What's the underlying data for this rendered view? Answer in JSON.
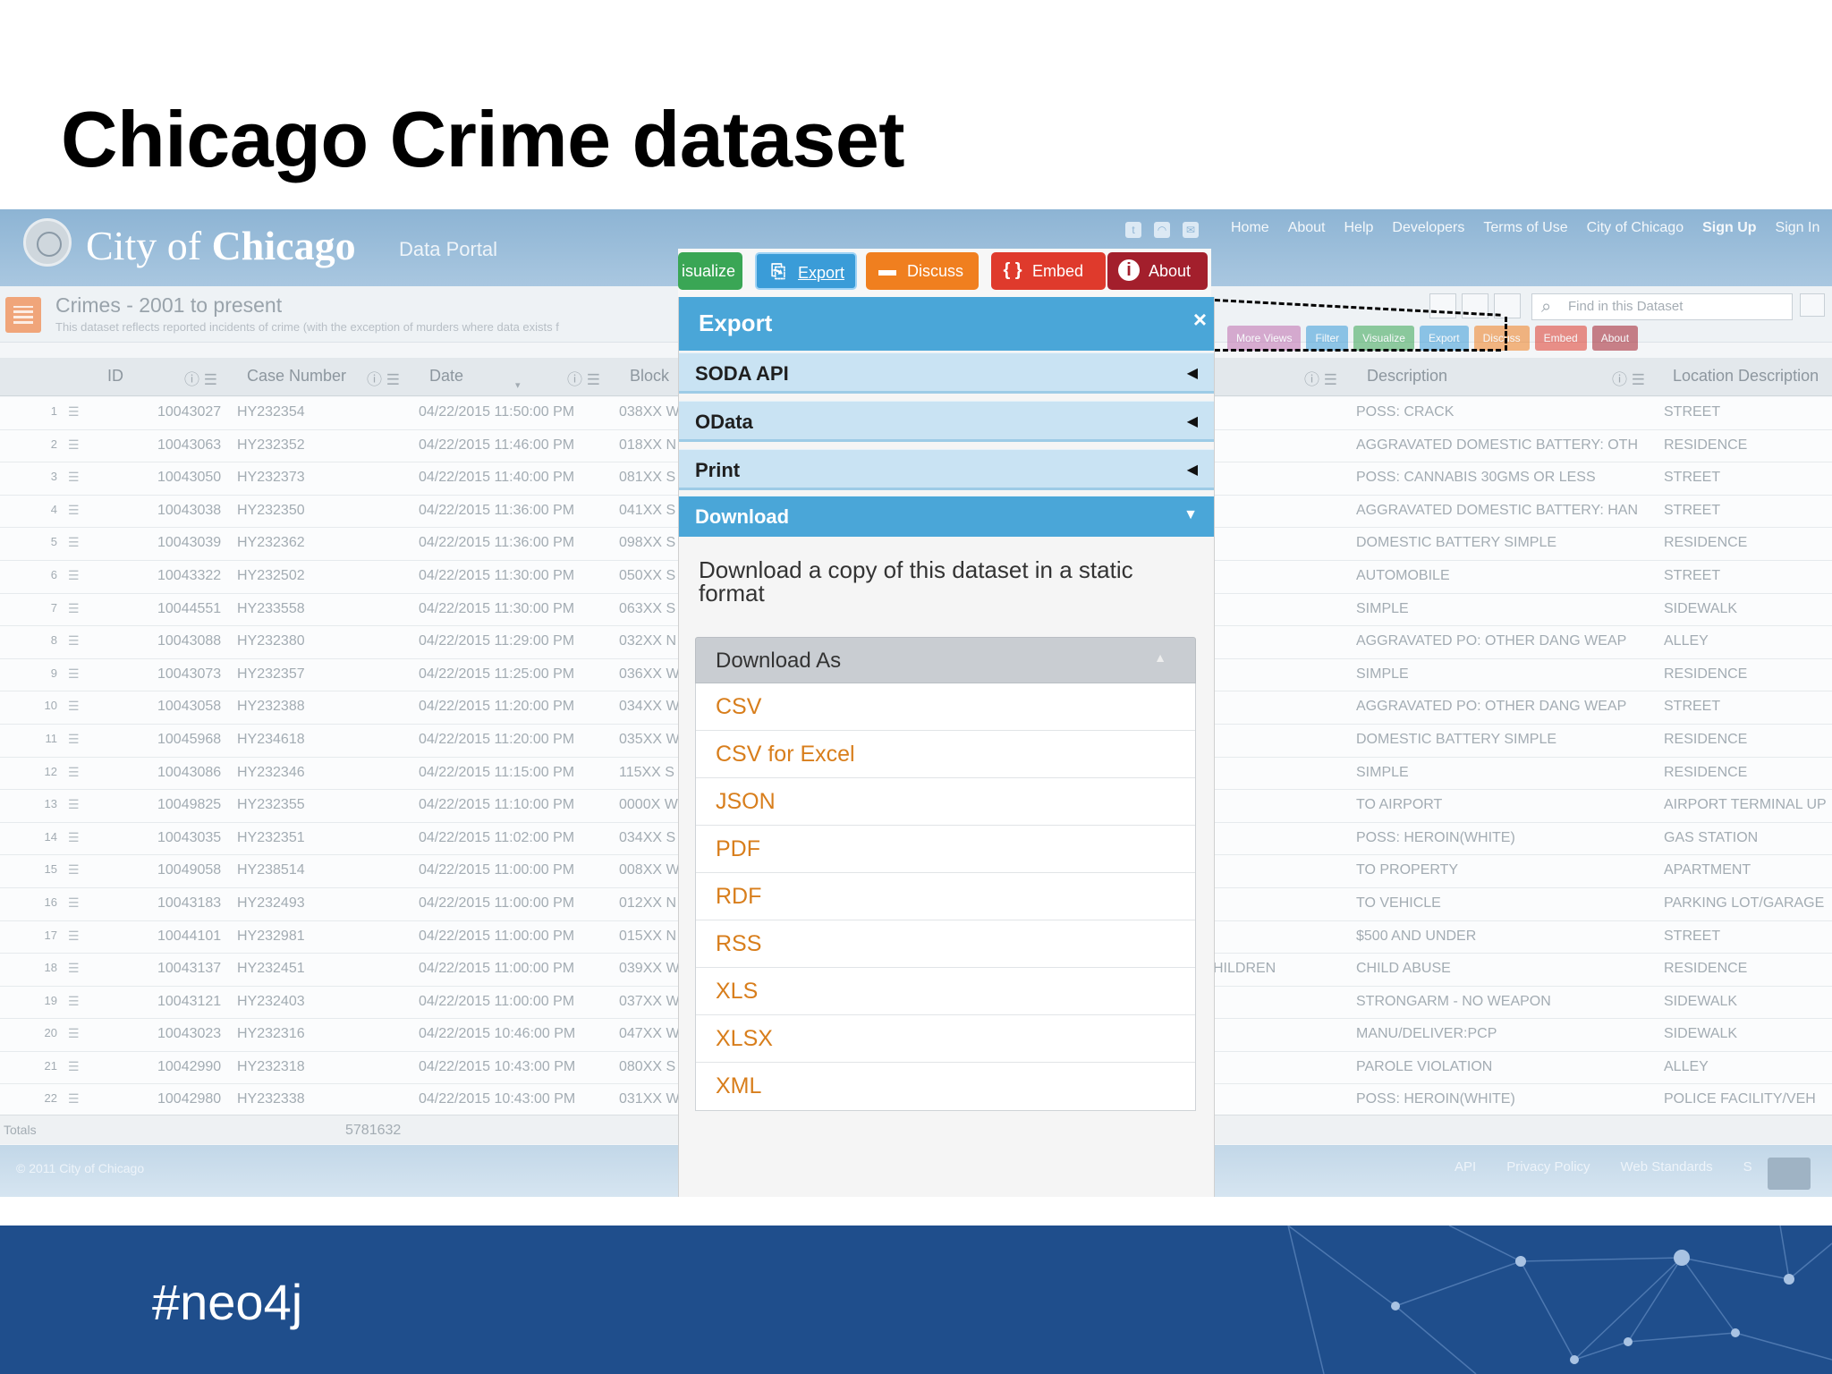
{
  "slide": {
    "title": "Chicago Crime dataset",
    "hashtag": "#neo4j"
  },
  "portal": {
    "brand_light": "City of ",
    "brand_bold": "Chicago",
    "portal_label": "Data Portal",
    "nav": [
      "Home",
      "About",
      "Help",
      "Developers",
      "Terms of Use",
      "City of Chicago",
      "Sign Up",
      "Sign In"
    ],
    "social_icons": [
      "twitter-icon",
      "rss-icon",
      "email-icon"
    ]
  },
  "dataset": {
    "title": "Crimes - 2001 to present",
    "description": "This dataset reflects reported incidents of crime (with the exception of murders where data exists f",
    "search_placeholder": "Find in this Dataset",
    "toolbar": [
      "More Views",
      "Filter",
      "Visualize",
      "Export",
      "Discuss",
      "Embed",
      "About"
    ],
    "toolbar_colors": [
      "#c06fb0",
      "#3a9cd8",
      "#3aa655",
      "#3a9cd8",
      "#f07f1f",
      "#df3a2c",
      "#a31f2c"
    ]
  },
  "table": {
    "columns": [
      "ID",
      "Case Number",
      "Date",
      "Block",
      "Description",
      "Location Description"
    ],
    "rows": [
      {
        "n": "1",
        "id": "10043027",
        "case": "HY232354",
        "date": "04/22/2015 11:50:00 PM",
        "block": "038XX W",
        "extra": "",
        "desc": "POSS: CRACK",
        "loc": "STREET"
      },
      {
        "n": "2",
        "id": "10043063",
        "case": "HY232352",
        "date": "04/22/2015 11:46:00 PM",
        "block": "018XX N",
        "extra": "",
        "desc": "AGGRAVATED DOMESTIC BATTERY: OTH",
        "loc": "RESIDENCE"
      },
      {
        "n": "3",
        "id": "10043050",
        "case": "HY232373",
        "date": "04/22/2015 11:40:00 PM",
        "block": "081XX S",
        "extra": "",
        "desc": "POSS: CANNABIS 30GMS OR LESS",
        "loc": "STREET"
      },
      {
        "n": "4",
        "id": "10043038",
        "case": "HY232350",
        "date": "04/22/2015 11:36:00 PM",
        "block": "041XX S",
        "extra": "",
        "desc": "AGGRAVATED DOMESTIC BATTERY: HAN",
        "loc": "STREET"
      },
      {
        "n": "5",
        "id": "10043039",
        "case": "HY232362",
        "date": "04/22/2015 11:36:00 PM",
        "block": "098XX S",
        "extra": "",
        "desc": "DOMESTIC BATTERY SIMPLE",
        "loc": "RESIDENCE"
      },
      {
        "n": "6",
        "id": "10043322",
        "case": "HY232502",
        "date": "04/22/2015 11:30:00 PM",
        "block": "050XX S",
        "extra": "",
        "desc": "AUTOMOBILE",
        "loc": "STREET"
      },
      {
        "n": "7",
        "id": "10044551",
        "case": "HY233558",
        "date": "04/22/2015 11:30:00 PM",
        "block": "063XX S",
        "extra": "",
        "desc": "SIMPLE",
        "loc": "SIDEWALK"
      },
      {
        "n": "8",
        "id": "10043088",
        "case": "HY232380",
        "date": "04/22/2015 11:29:00 PM",
        "block": "032XX N",
        "extra": "",
        "desc": "AGGRAVATED PO: OTHER DANG WEAP",
        "loc": "ALLEY"
      },
      {
        "n": "9",
        "id": "10043073",
        "case": "HY232357",
        "date": "04/22/2015 11:25:00 PM",
        "block": "036XX W",
        "extra": "",
        "desc": "SIMPLE",
        "loc": "RESIDENCE"
      },
      {
        "n": "10",
        "id": "10043058",
        "case": "HY232388",
        "date": "04/22/2015 11:20:00 PM",
        "block": "034XX W",
        "extra": "",
        "desc": "AGGRAVATED PO: OTHER DANG WEAP",
        "loc": "STREET"
      },
      {
        "n": "11",
        "id": "10045968",
        "case": "HY234618",
        "date": "04/22/2015 11:20:00 PM",
        "block": "035XX W",
        "extra": "",
        "desc": "DOMESTIC BATTERY SIMPLE",
        "loc": "RESIDENCE"
      },
      {
        "n": "12",
        "id": "10043086",
        "case": "HY232346",
        "date": "04/22/2015 11:15:00 PM",
        "block": "115XX S",
        "extra": "",
        "desc": "SIMPLE",
        "loc": "RESIDENCE"
      },
      {
        "n": "13",
        "id": "10049825",
        "case": "HY232355",
        "date": "04/22/2015 11:10:00 PM",
        "block": "0000X W",
        "extra": "",
        "desc": "TO AIRPORT",
        "loc": "AIRPORT TERMINAL UP"
      },
      {
        "n": "14",
        "id": "10043035",
        "case": "HY232351",
        "date": "04/22/2015 11:02:00 PM",
        "block": "034XX S",
        "extra": "",
        "desc": "POSS: HEROIN(WHITE)",
        "loc": "GAS STATION"
      },
      {
        "n": "15",
        "id": "10049058",
        "case": "HY238514",
        "date": "04/22/2015 11:00:00 PM",
        "block": "008XX W",
        "extra": "",
        "desc": "TO PROPERTY",
        "loc": "APARTMENT"
      },
      {
        "n": "16",
        "id": "10043183",
        "case": "HY232493",
        "date": "04/22/2015 11:00:00 PM",
        "block": "012XX N",
        "extra": "",
        "desc": "TO VEHICLE",
        "loc": "PARKING LOT/GARAGE"
      },
      {
        "n": "17",
        "id": "10044101",
        "case": "HY232981",
        "date": "04/22/2015 11:00:00 PM",
        "block": "015XX N",
        "extra": "",
        "desc": "$500 AND UNDER",
        "loc": "STREET"
      },
      {
        "n": "18",
        "id": "10043137",
        "case": "HY232451",
        "date": "04/22/2015 11:00:00 PM",
        "block": "039XX W",
        "extra": "HILDREN",
        "desc": "CHILD ABUSE",
        "loc": "RESIDENCE"
      },
      {
        "n": "19",
        "id": "10043121",
        "case": "HY232403",
        "date": "04/22/2015 11:00:00 PM",
        "block": "037XX W",
        "extra": "",
        "desc": "STRONGARM - NO WEAPON",
        "loc": "SIDEWALK"
      },
      {
        "n": "20",
        "id": "10043023",
        "case": "HY232316",
        "date": "04/22/2015 10:46:00 PM",
        "block": "047XX W",
        "extra": "",
        "desc": "MANU/DELIVER:PCP",
        "loc": "SIDEWALK"
      },
      {
        "n": "21",
        "id": "10042990",
        "case": "HY232318",
        "date": "04/22/2015 10:43:00 PM",
        "block": "080XX S",
        "extra": "",
        "desc": "PAROLE VIOLATION",
        "loc": "ALLEY"
      },
      {
        "n": "22",
        "id": "10042980",
        "case": "HY232338",
        "date": "04/22/2015 10:43:00 PM",
        "block": "031XX W",
        "extra": "",
        "desc": "POSS: HEROIN(WHITE)",
        "loc": "POLICE FACILITY/VEH"
      }
    ],
    "totals_label": "Totals",
    "totals_value": "5781632"
  },
  "footer": {
    "copyright": "© 2011 City of Chicago",
    "links": [
      "API",
      "Privacy Policy",
      "Web Standards",
      "S"
    ]
  },
  "export_panel": {
    "buttons": {
      "visualize": "isualize",
      "export": "Export",
      "discuss": "Discuss",
      "embed": "Embed",
      "about": "About"
    },
    "title": "Export",
    "close": "×",
    "sections": [
      "SODA API",
      "OData",
      "Print",
      "Download"
    ],
    "download_description": "Download a copy of this dataset in a static format",
    "download_as": "Download As",
    "formats": [
      "CSV",
      "CSV for Excel",
      "JSON",
      "PDF",
      "RDF",
      "RSS",
      "XLS",
      "XLSX",
      "XML"
    ]
  }
}
